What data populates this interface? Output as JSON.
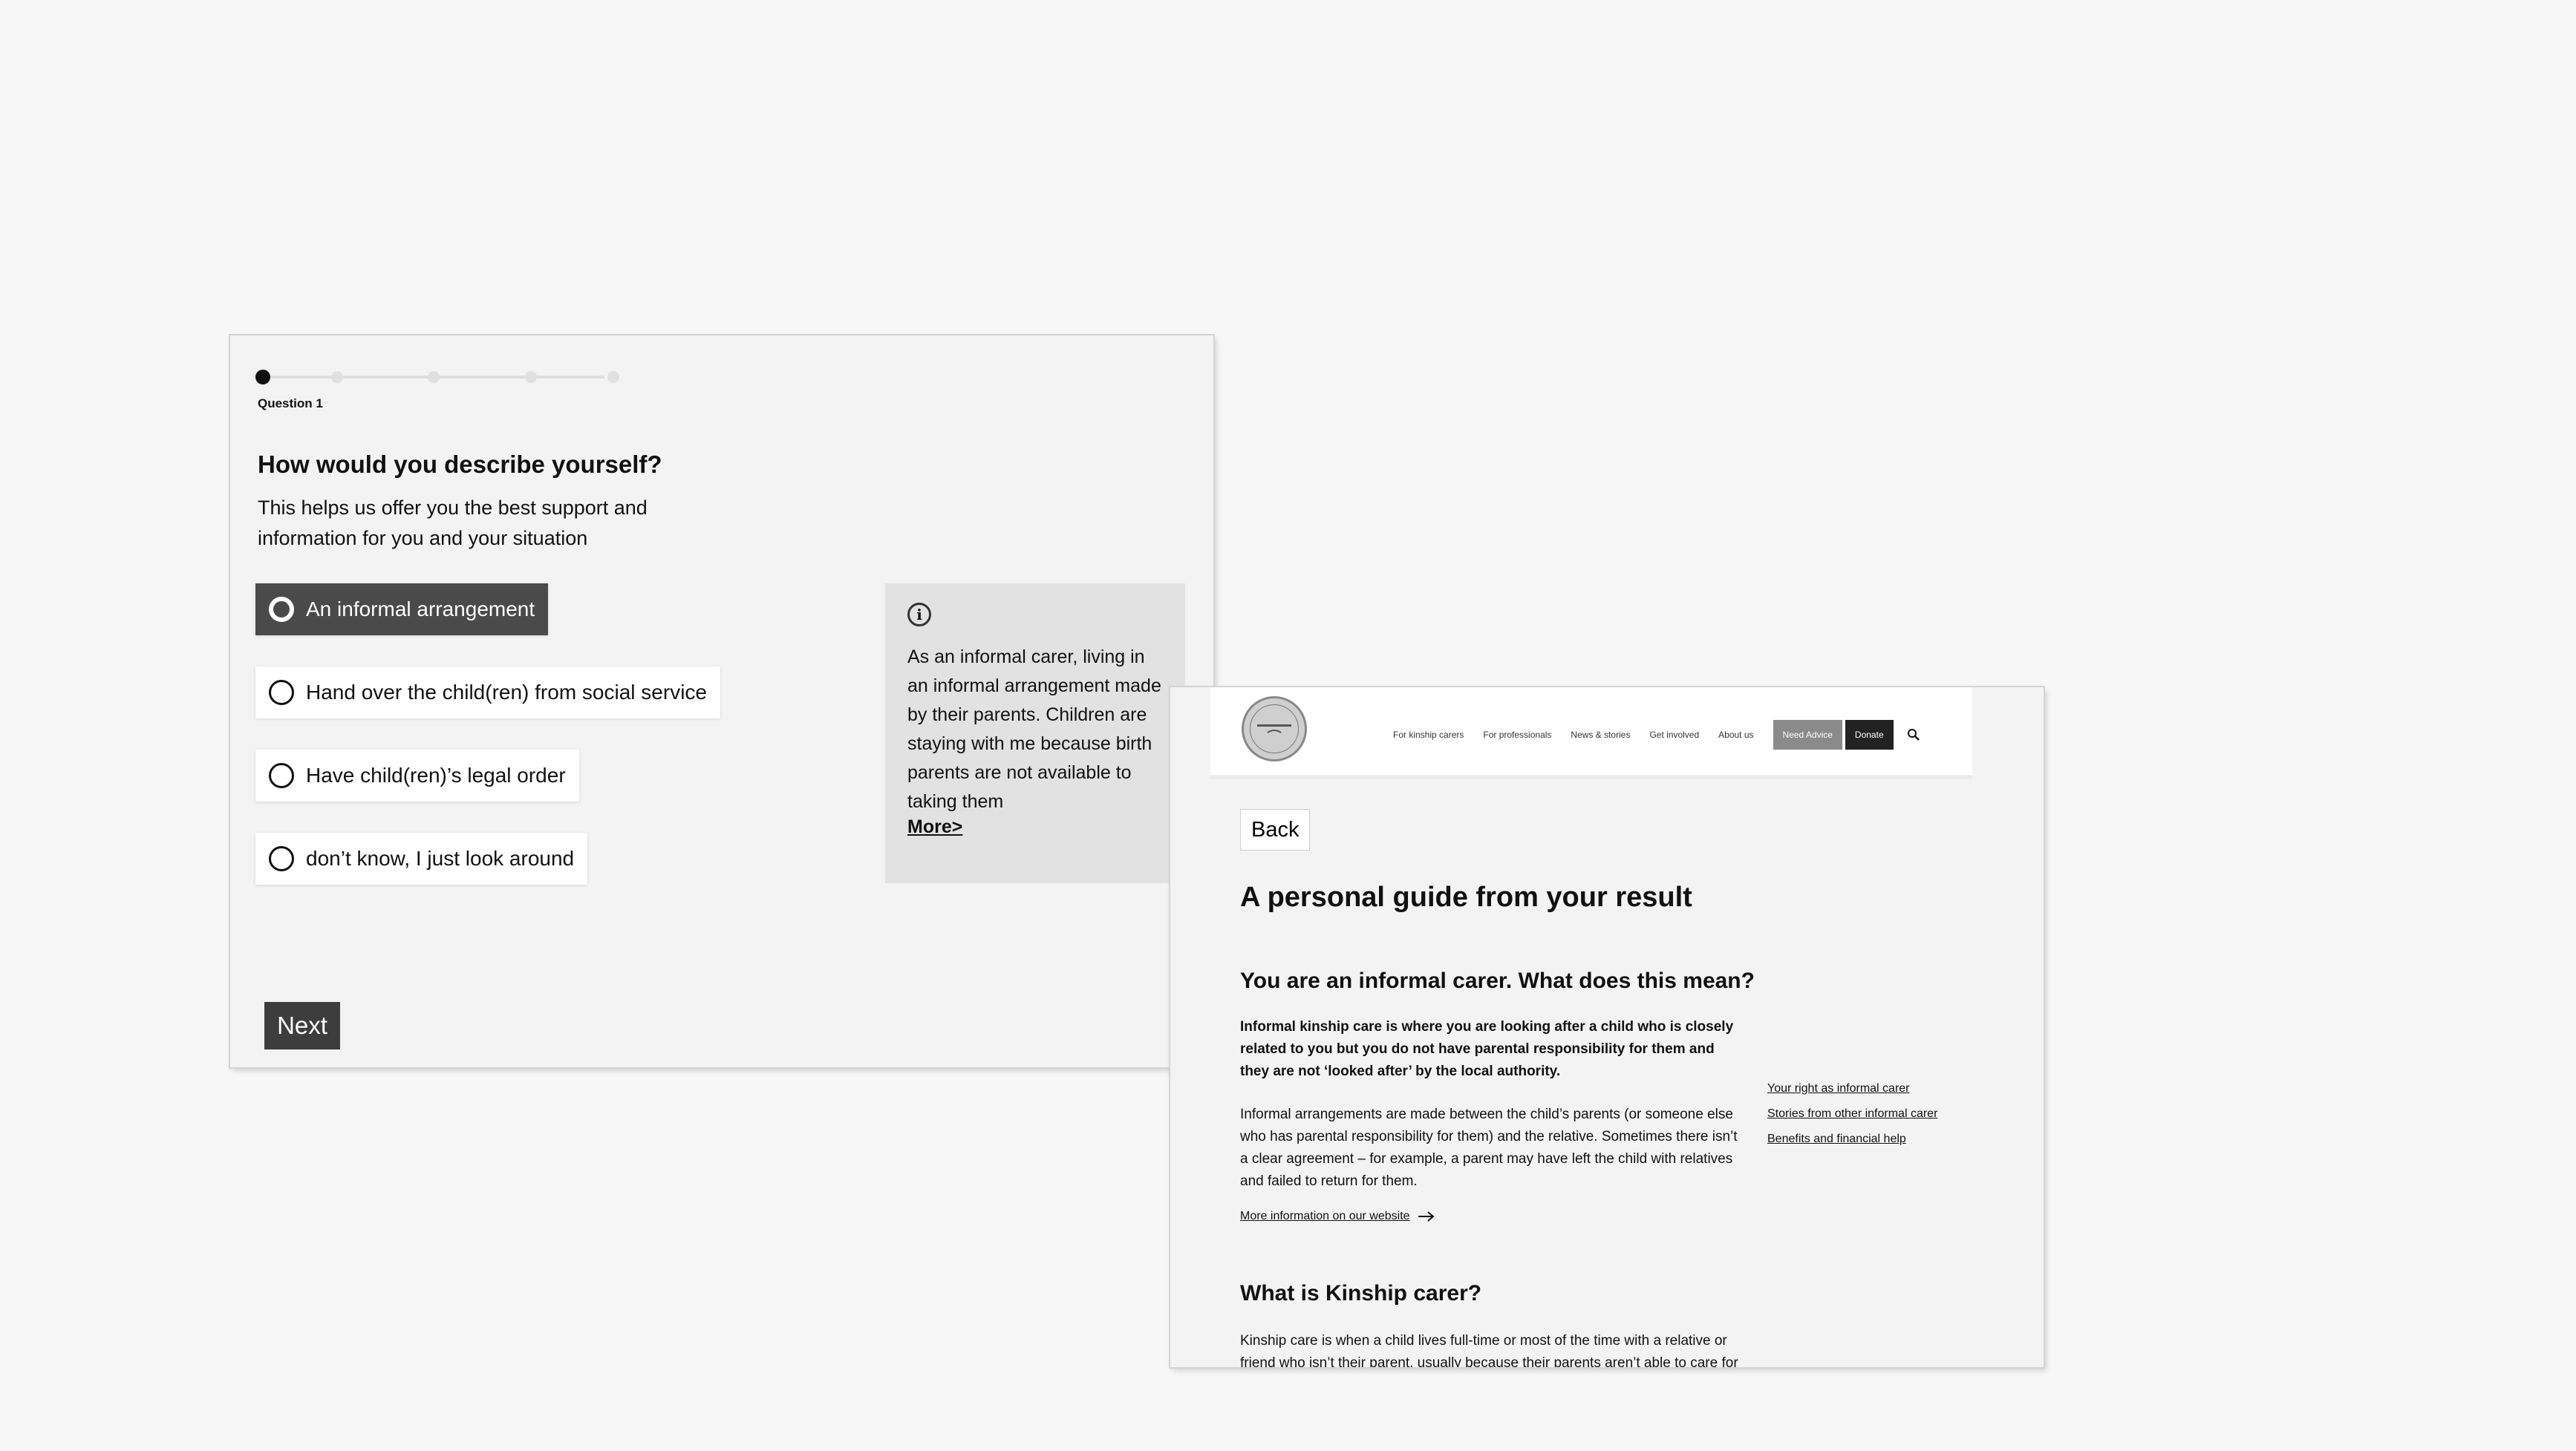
{
  "quiz": {
    "steps": 5,
    "current_step": 1,
    "question_label": "Question 1",
    "title": "How would you describe yourself?",
    "subtitle": "This helps us offer you the best support and information for you and your situation",
    "options": [
      {
        "label": "An informal arrangement",
        "selected": true
      },
      {
        "label": "Hand over the child(ren) from social service",
        "selected": false
      },
      {
        "label": "Have child(ren)’s legal order",
        "selected": false
      },
      {
        "label": "don’t know, I just look around",
        "selected": false
      }
    ],
    "info": {
      "icon": "info-icon",
      "text": "As an informal carer, living in an informal arrangement made by their parents. Children are staying with me because birth parents are not available to taking them",
      "more_link": "More>"
    },
    "next_label": "Next"
  },
  "result": {
    "header": {
      "logo_icon": "grandparents-plus-logo",
      "nav": [
        "For kinship carers",
        "For professionals",
        "News & stories",
        "Get involved",
        "About us"
      ],
      "advice_button": "Need Advice",
      "donate_button": "Donate",
      "search_icon": "search-icon"
    },
    "back_label": "Back",
    "title": "A personal guide from your result",
    "section1": {
      "heading": "You are an informal carer. What does this mean?",
      "bold_text": "Informal kinship care is where you are looking after a child who is closely related to you but you do not have parental responsibility for them and they are not ‘looked after’ by the local authority.",
      "body_text": "Informal arrangements are made between the child’s parents (or someone else who has parental responsibility for them) and the relative.  Sometimes there isn’t a clear agreement – for example, a parent may have left the child with relatives and failed to return for them.",
      "link": "More information on our website"
    },
    "side_links": [
      "Your right as informal carer",
      "Stories from other informal carer",
      "Benefits and financial help"
    ],
    "section2": {
      "heading": "What is Kinship carer?",
      "body_text": "Kinship care is when a child lives full-time or most of the time with a relative or friend who isn’t their parent, usually because their parents aren’t able to care for them."
    }
  },
  "colors": {
    "selected_option": "#4a4a4a",
    "info_bg": "#e2e2e2",
    "next_button": "#3d3d3d",
    "advice_button": "#8a8a8a",
    "donate_button": "#222222"
  }
}
